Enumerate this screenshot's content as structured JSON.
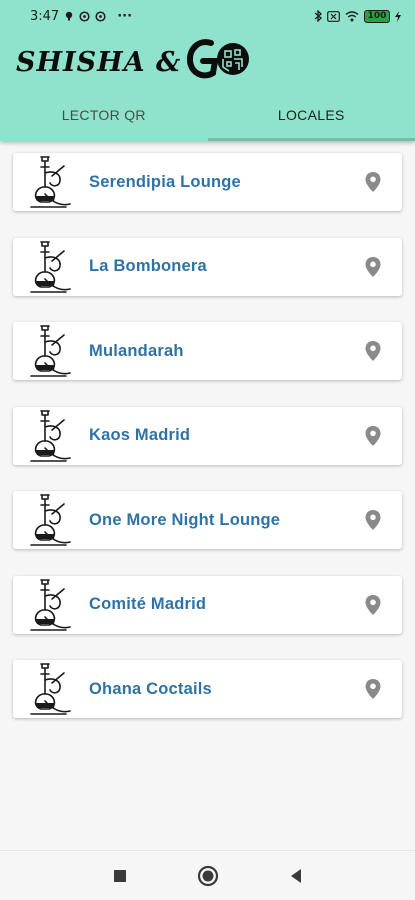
{
  "status_bar": {
    "time": "3:47",
    "dots": "···",
    "battery": "100"
  },
  "app": {
    "logo_text": "SHISHA & "
  },
  "tabs": [
    {
      "label": "LECTOR QR",
      "active": false
    },
    {
      "label": "LOCALES",
      "active": true
    }
  ],
  "venues": [
    {
      "name": "Serendipia Lounge",
      "icon": "hookah-icon",
      "action_icon": "location-pin-icon"
    },
    {
      "name": "La Bombonera",
      "icon": "hookah-icon",
      "action_icon": "location-pin-icon"
    },
    {
      "name": "Mulandarah",
      "icon": "hookah-icon",
      "action_icon": "location-pin-icon"
    },
    {
      "name": "Kaos Madrid",
      "icon": "hookah-icon",
      "action_icon": "location-pin-icon"
    },
    {
      "name": "One More Night Lounge",
      "icon": "hookah-icon",
      "action_icon": "location-pin-icon"
    },
    {
      "name": "Comité Madrid",
      "icon": "hookah-icon",
      "action_icon": "location-pin-icon"
    },
    {
      "name": "Ohana Coctails",
      "icon": "hookah-icon",
      "action_icon": "location-pin-icon"
    }
  ],
  "colors": {
    "header_bg": "#8fe3cd",
    "venue_text": "#2f73a6",
    "tab_indicator": "#6fbfa9",
    "pin": "#8a8a8a"
  },
  "nav_bar": {
    "buttons": [
      "square-recents-icon",
      "circle-home-icon",
      "triangle-back-icon"
    ]
  }
}
